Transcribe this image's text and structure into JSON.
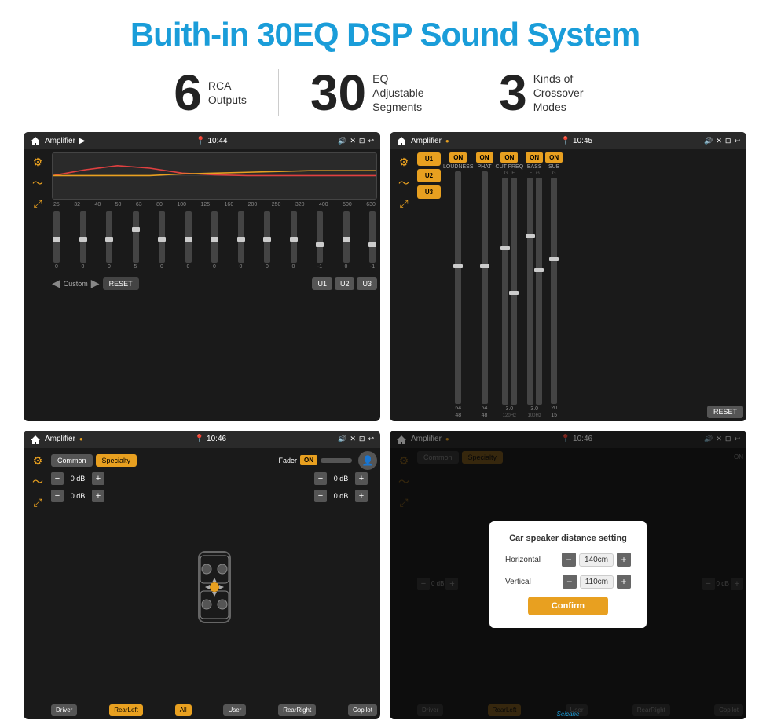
{
  "page": {
    "title": "Buith-in 30EQ DSP Sound System",
    "stats": [
      {
        "number": "6",
        "label": "RCA\nOutputs"
      },
      {
        "number": "30",
        "label": "EQ Adjustable\nSegments"
      },
      {
        "number": "3",
        "label": "Kinds of\nCrossover Modes"
      }
    ],
    "screens": [
      {
        "id": "screen1",
        "title": "Amplifier",
        "time": "10:44",
        "type": "eq",
        "freq_labels": [
          "25",
          "32",
          "40",
          "50",
          "63",
          "80",
          "100",
          "125",
          "160",
          "200",
          "250",
          "320",
          "400",
          "500",
          "630"
        ],
        "slider_values": [
          "0",
          "0",
          "0",
          "5",
          "0",
          "0",
          "0",
          "0",
          "0",
          "0",
          "-1",
          "0",
          "-1"
        ],
        "bottom_btns": [
          "Custom",
          "RESET",
          "U1",
          "U2",
          "U3"
        ]
      },
      {
        "id": "screen2",
        "title": "Amplifier",
        "time": "10:45",
        "type": "amplifier",
        "presets": [
          "U1",
          "U2",
          "U3"
        ],
        "controls": [
          "LOUDNESS",
          "PHAT",
          "CUT FREQ",
          "BASS",
          "SUB"
        ],
        "reset_btn": "RESET"
      },
      {
        "id": "screen3",
        "title": "Amplifier",
        "time": "10:46",
        "type": "speaker",
        "tabs": [
          "Common",
          "Specialty"
        ],
        "fader_label": "Fader",
        "fader_on": "ON",
        "positions": [
          "Driver",
          "RearLeft",
          "All",
          "User",
          "RearRight",
          "Copilot"
        ],
        "db_values": [
          "0 dB",
          "0 dB",
          "0 dB",
          "0 dB"
        ]
      },
      {
        "id": "screen4",
        "title": "Amplifier",
        "time": "10:46",
        "type": "dialog",
        "dialog": {
          "title": "Car speaker distance setting",
          "horizontal_label": "Horizontal",
          "horizontal_value": "140cm",
          "vertical_label": "Vertical",
          "vertical_value": "110cm",
          "confirm_btn": "Confirm"
        },
        "watermark": "Seicane"
      }
    ]
  }
}
